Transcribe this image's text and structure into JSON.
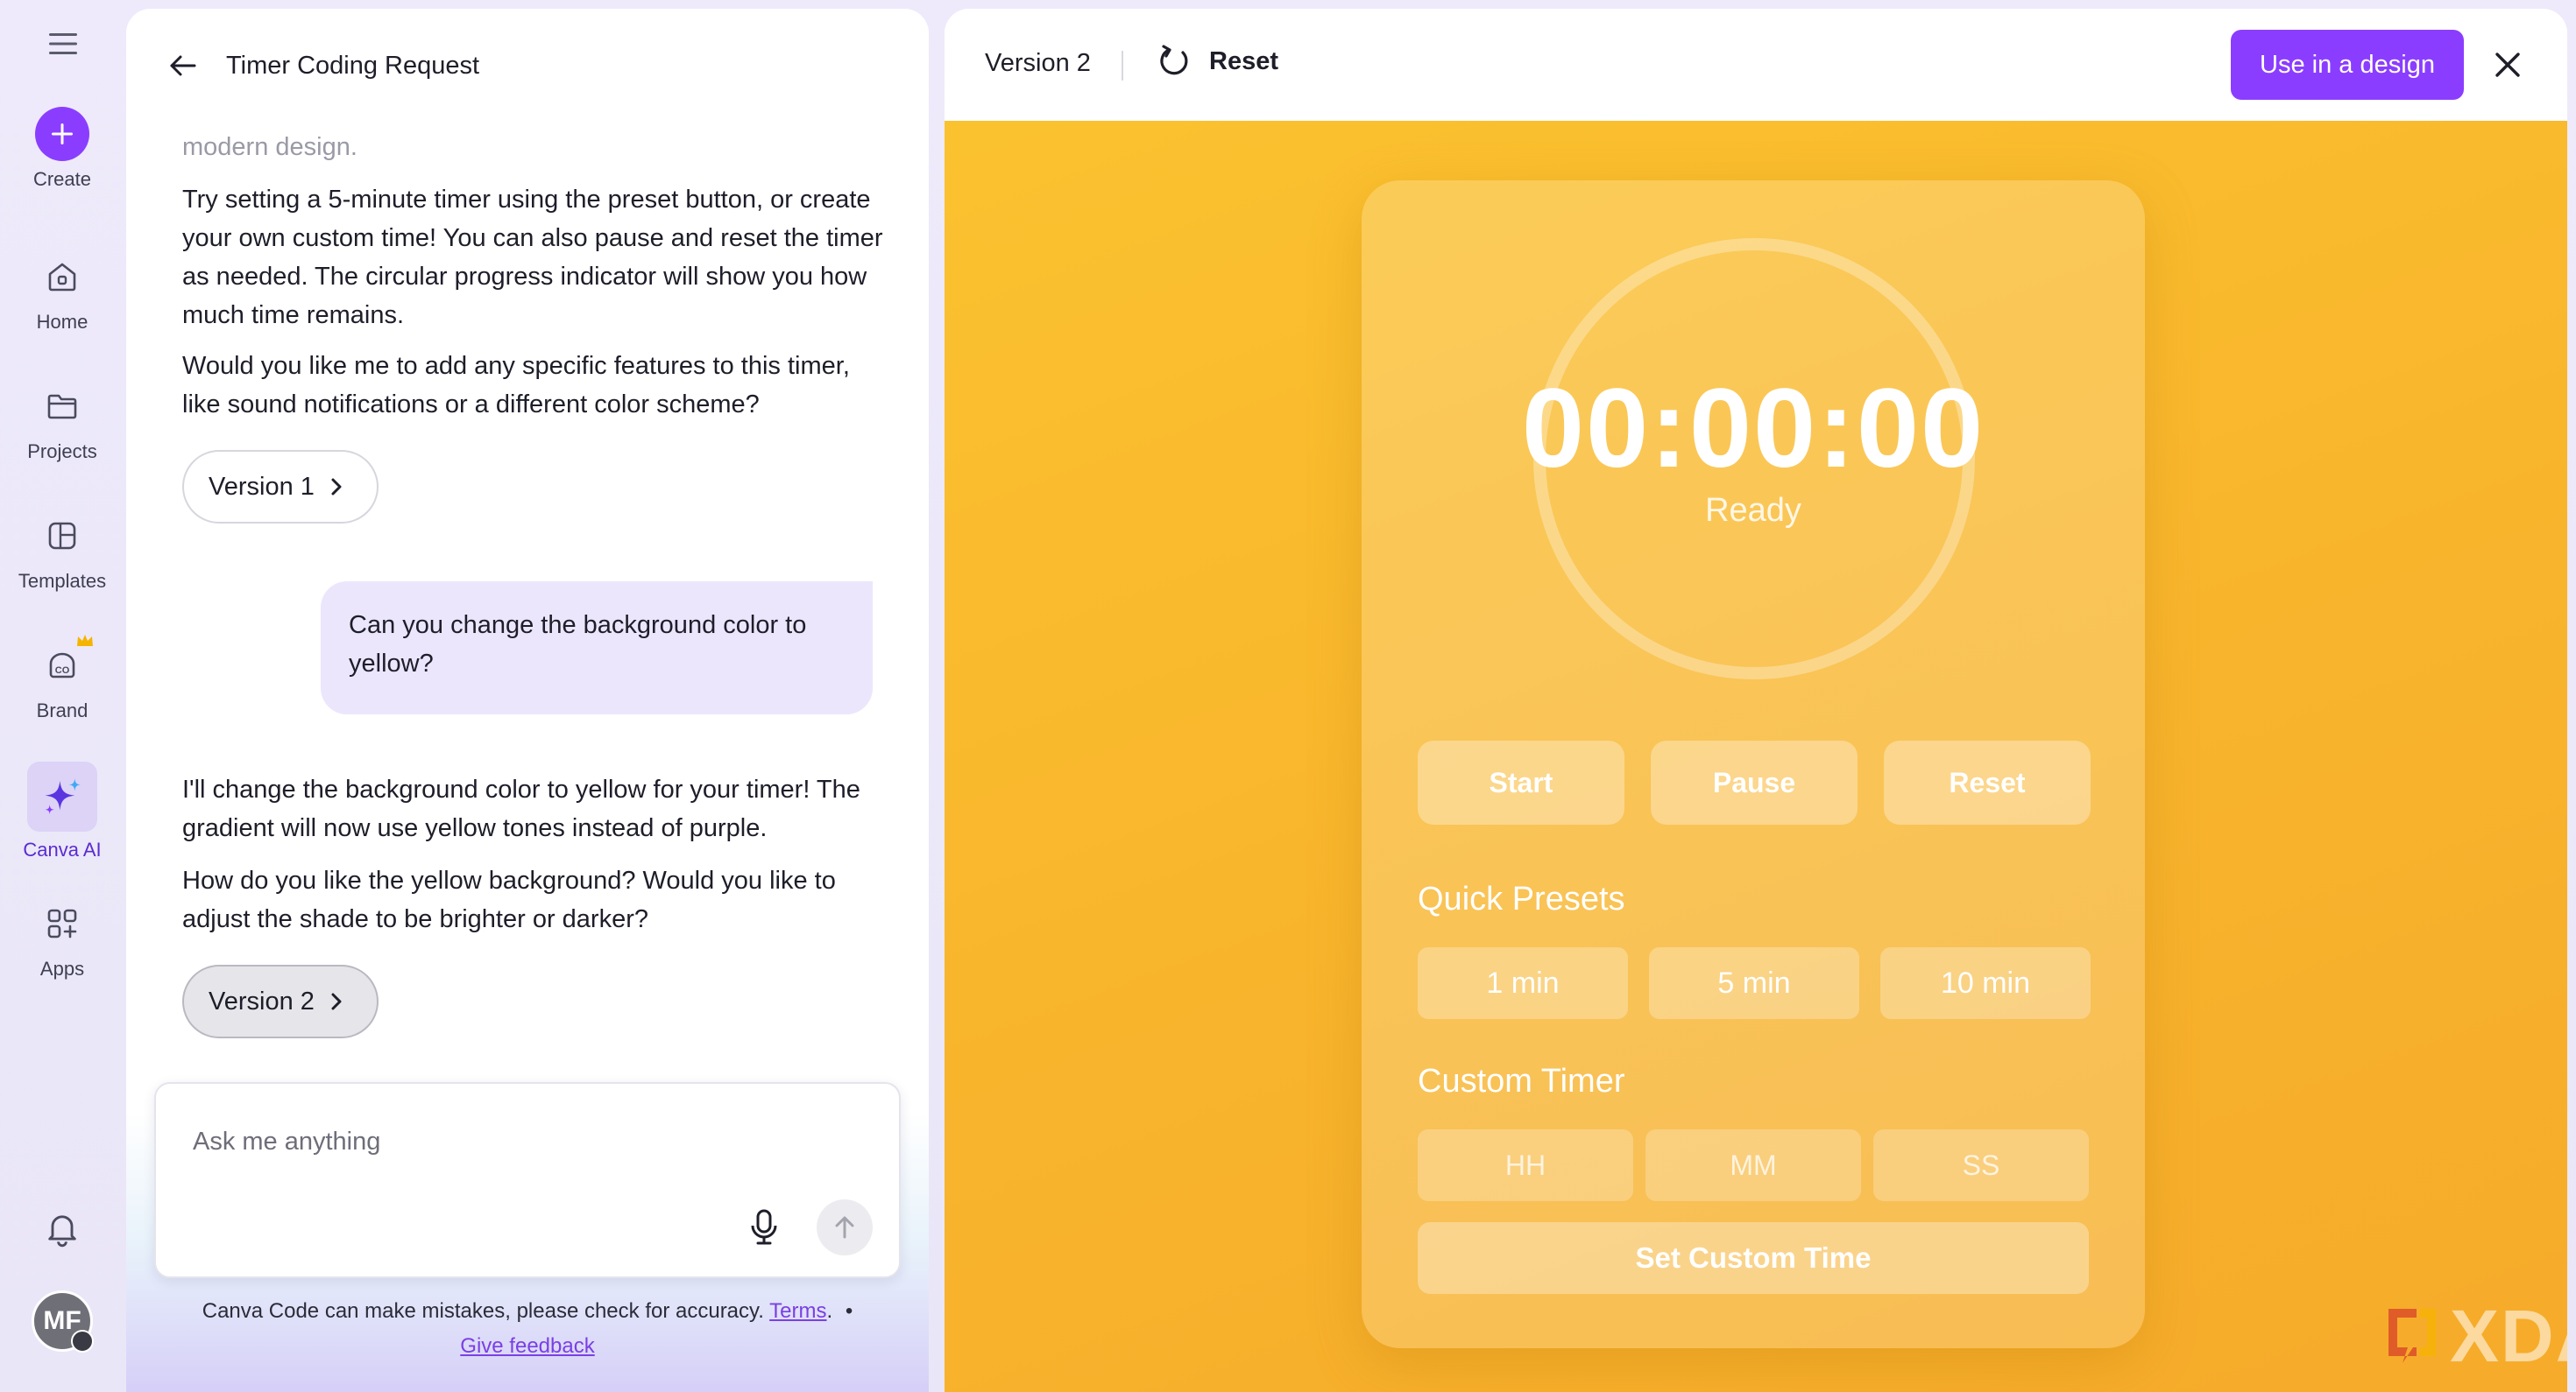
{
  "sidebar": {
    "items": [
      {
        "label": "Create"
      },
      {
        "label": "Home"
      },
      {
        "label": "Projects"
      },
      {
        "label": "Templates"
      },
      {
        "label": "Brand"
      },
      {
        "label": "Canva AI"
      },
      {
        "label": "Apps"
      }
    ],
    "avatar_initials": "MF"
  },
  "chat": {
    "title": "Timer Coding Request",
    "faded_text": "modern design.",
    "messages": [
      {
        "role": "assistant",
        "text": "Try setting a 5-minute timer using the preset button, or create your own custom time! You can also pause and reset the timer as needed. The circular progress indicator will show you how much time remains."
      },
      {
        "role": "assistant",
        "text": "Would you like me to add any specific features to this timer, like sound notifications or a different color scheme?"
      },
      {
        "role": "user",
        "text": "Can you change the background color to yellow?"
      },
      {
        "role": "assistant",
        "text": "I'll change the background color to yellow for your timer! The gradient will now use yellow tones instead of purple."
      },
      {
        "role": "assistant",
        "text": "How do you like the yellow background? Would you like to adjust the shade to be brighter or darker?"
      }
    ],
    "version_pills": [
      "Version 1",
      "Version 2"
    ],
    "input_placeholder": "Ask me anything",
    "disclaimer": "Canva Code can make mistakes, please check for accuracy.",
    "terms_link": "Terms",
    "separator": ".",
    "bullet": "•",
    "feedback_link": "Give feedback"
  },
  "preview": {
    "version_label": "Version 2",
    "reset_label": "Reset",
    "use_in_design_label": "Use in a design",
    "accent": "#8b3dff",
    "stage_color": "#f8b42c",
    "timer": {
      "time": "00:00:00",
      "status": "Ready",
      "controls": [
        "Start",
        "Pause",
        "Reset"
      ],
      "quick_presets_title": "Quick Presets",
      "presets": [
        "1 min",
        "5 min",
        "10 min"
      ],
      "custom_timer_title": "Custom Timer",
      "custom_inputs": [
        "HH",
        "MM",
        "SS"
      ],
      "set_custom_label": "Set Custom Time"
    },
    "watermark": "XDA"
  },
  "icons": [
    "menu-icon",
    "plus-icon",
    "home-icon",
    "folder-icon",
    "templates-icon",
    "brand-icon",
    "crown-icon",
    "sparkle-icon",
    "apps-icon",
    "bell-icon",
    "back-arrow-icon",
    "chevron-right-icon",
    "mic-icon",
    "send-arrow-icon",
    "refresh-icon",
    "close-icon"
  ]
}
